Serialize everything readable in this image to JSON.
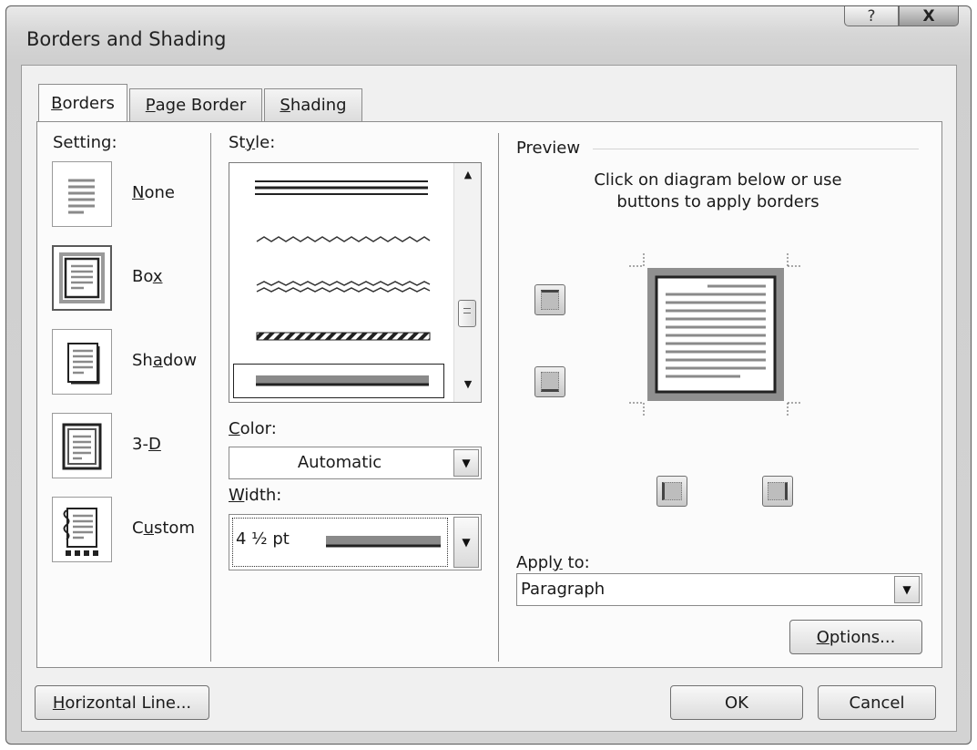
{
  "window": {
    "title": "Borders and Shading",
    "help_label": "?",
    "close_label": "X"
  },
  "tabs": [
    {
      "label_pre": "",
      "accel": "B",
      "label_post": "orders",
      "active": true
    },
    {
      "label_pre": "",
      "accel": "P",
      "label_post": "age Border",
      "active": false
    },
    {
      "label_pre": "",
      "accel": "S",
      "label_post": "hading",
      "active": false
    }
  ],
  "setting": {
    "label": "Setting:",
    "options": [
      {
        "pre": "",
        "accel": "N",
        "post": "one",
        "icon": "setting-none-icon"
      },
      {
        "pre": "Bo",
        "accel": "x",
        "post": "",
        "icon": "setting-box-icon"
      },
      {
        "pre": "Sh",
        "accel": "a",
        "post": "dow",
        "icon": "setting-shadow-icon"
      },
      {
        "pre": "3-",
        "accel": "D",
        "post": "",
        "icon": "setting-3d-icon"
      },
      {
        "pre": "C",
        "accel": "u",
        "post": "stom",
        "icon": "setting-custom-icon"
      }
    ],
    "selected": "Box"
  },
  "style": {
    "label_pre": "St",
    "label_accel": "y",
    "label_post": "le:"
  },
  "color": {
    "label_pre": "",
    "label_accel": "C",
    "label_post": "olor:",
    "value": "Automatic"
  },
  "width": {
    "label_pre": "",
    "label_accel": "W",
    "label_post": "idth:",
    "value": "4 ½ pt"
  },
  "preview": {
    "label": "Preview",
    "instructions_line1": "Click on diagram below or use",
    "instructions_line2": "buttons to apply borders"
  },
  "apply_to": {
    "label_pre": "Appl",
    "label_accel": "y",
    "label_post": " to:",
    "value": "Paragraph"
  },
  "buttons": {
    "options_pre": "",
    "options_accel": "O",
    "options_post": "ptions...",
    "horizontal_pre": "",
    "horizontal_accel": "H",
    "horizontal_post": "orizontal Line...",
    "ok": "OK",
    "cancel": "Cancel"
  },
  "colors": {
    "accent_border": "#8f8f8f",
    "selected_line": "#3a3a3a"
  }
}
